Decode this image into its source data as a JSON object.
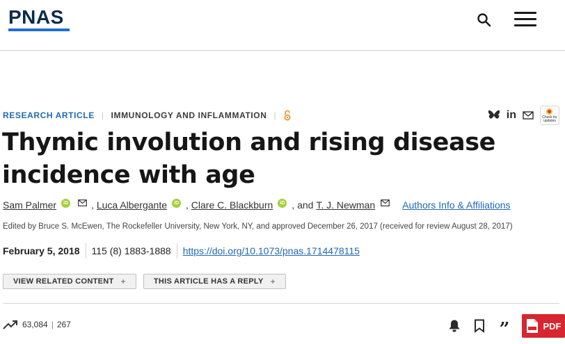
{
  "header": {
    "logo_text": "PNAS",
    "icons": {
      "search": "search-icon",
      "menu": "hamburger-menu-icon"
    }
  },
  "meta": {
    "article_type": "RESEARCH ARTICLE",
    "subject": "IMMUNOLOGY AND INFLAMMATION",
    "open_access_icon": "open-access-lock-icon"
  },
  "share": {
    "icons": [
      "bluesky-icon",
      "linkedin-icon",
      "email-icon",
      "crossmark-icon"
    ],
    "linkedin_label": "in",
    "crossmark_label": "Check for updates"
  },
  "article": {
    "title": "Thymic involution and rising disease incidence with age",
    "authors": [
      {
        "name": "Sam Palmer",
        "orcid": true,
        "email": true
      },
      {
        "name": "Luca Albergante",
        "orcid": true,
        "email": false
      },
      {
        "name": "Clare C. Blackburn",
        "orcid": true,
        "email": false
      },
      {
        "name": "T. J. Newman",
        "orcid": false,
        "email": true
      }
    ],
    "sep_comma": ",",
    "sep_and": ", and",
    "orcid_label": "iD",
    "affiliations_link": "Authors Info & Affiliations",
    "edited_by": "Edited by Bruce S. McEwen, The Rockefeller University, New York, NY, and approved December 26, 2017 (received for review August 28, 2017)",
    "pub_date": "February 5, 2018",
    "citation": "115 (8) 1883-1888",
    "doi": "https://doi.org/10.1073/pnas.1714478115"
  },
  "buttons": {
    "related": "VIEW RELATED CONTENT",
    "reply": "THIS ARTICLE HAS A REPLY",
    "plus": "+"
  },
  "metrics": {
    "views": "63,084",
    "separator": "|",
    "citations": "267"
  },
  "tools": {
    "icons": [
      "bell-icon",
      "bookmark-icon",
      "quote-icon",
      "pdf-icon"
    ],
    "pdf_label": "PDF"
  },
  "colors": {
    "brand_navy": "#0d2b4c",
    "link_blue": "#2069b3",
    "orcid_green": "#a6ce39",
    "pdf_red": "#d7262f",
    "open_access_orange": "#f28a1e"
  }
}
